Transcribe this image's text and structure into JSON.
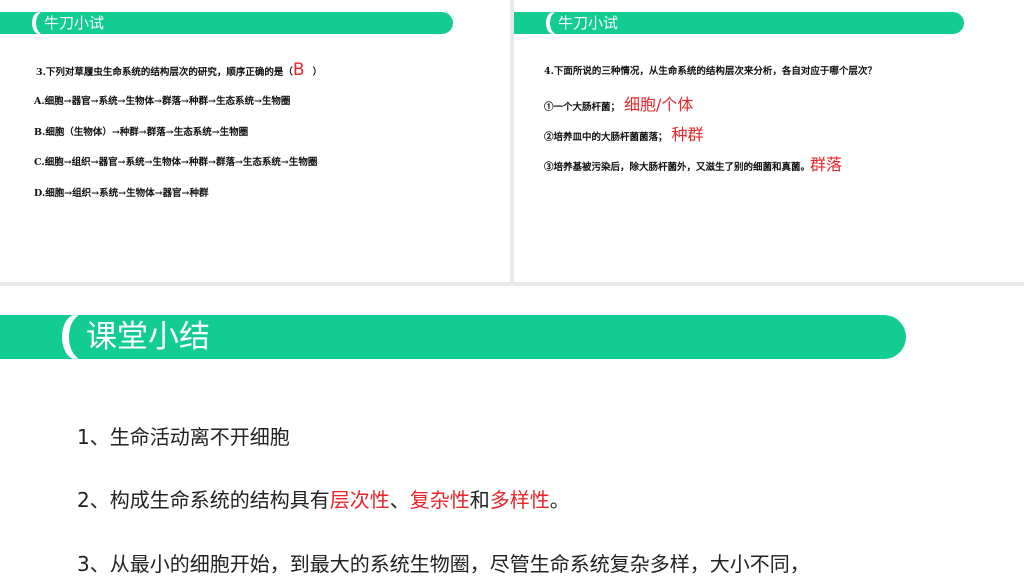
{
  "slide_left": {
    "banner_title": "牛刀小试",
    "question": "3.下列对草履虫生命系统的结构层次的研究，顺序正确的是（",
    "answer": "B",
    "question_end": "）",
    "options": [
      "A.细胞→器官→系统→生物体→群落→种群→生态系统→生物圈",
      "B.细胞（生物体）→种群→群落→生态系统→生物圈",
      "C.细胞→组织→器官→系统→生物体→种群→群落→生态系统→生物圈",
      "D.细胞→组织→系统→生物体→器官→种群"
    ]
  },
  "slide_right": {
    "banner_title": "牛刀小试",
    "question": "4.下面所说的三种情况，从生命系统的结构层次来分析，各自对应于哪个层次？",
    "items": [
      {
        "text": "①一个大肠杆菌；",
        "answer": "细胞/个体"
      },
      {
        "text": "②培养皿中的大肠杆菌菌落；",
        "answer": "种群"
      },
      {
        "text": "③培养基被污染后，除大肠杆菌外，又滋生了别的细菌和真菌。",
        "answer": "群落"
      }
    ]
  },
  "summary": {
    "banner_title": "课堂小结",
    "point1": "1、生命活动离不开细胞",
    "point2": {
      "prefix": "2、构成生命系统的结构具有",
      "term1": "层次性",
      "sep1": "、",
      "term2": "复杂性",
      "sep2": "和",
      "term3": "多样性",
      "end": "。"
    },
    "point3": "3、从最小的细胞开始，到最大的系统生物圈，尽管生命系统复杂多样，大小不同，"
  },
  "colors": {
    "banner": "#13cc91",
    "answer_red": "#e8262b",
    "text": "#222222"
  }
}
